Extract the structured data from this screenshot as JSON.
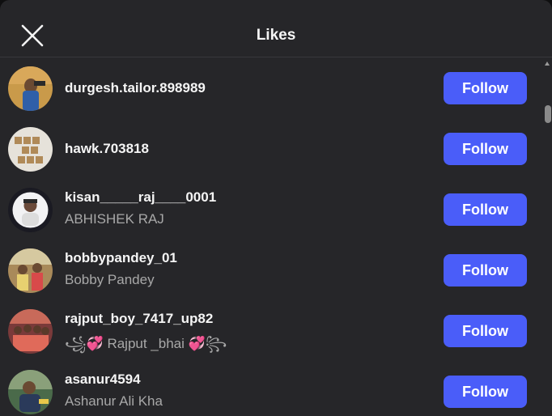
{
  "dialog": {
    "title": "Likes",
    "close_icon": "close-x-icon"
  },
  "users": [
    {
      "username": "durgesh.tailor.898989",
      "fullname": "",
      "button": "Follow",
      "avatar_color": "#3a6fb0"
    },
    {
      "username": "hawk.703818",
      "fullname": "",
      "button": "Follow",
      "avatar_color": "#c9b08a"
    },
    {
      "username": "kisan_____raj____0001",
      "fullname": "ABHISHEK RAJ",
      "button": "Follow",
      "avatar_color": "#e8e8ea"
    },
    {
      "username": "bobbypandey_01",
      "fullname": "Bobby Pandey",
      "button": "Follow",
      "avatar_color": "#b79a6a"
    },
    {
      "username": "rajput_boy_7417_up82",
      "fullname": "꧁💞 Rajput _bhai 💞꧂",
      "button": "Follow",
      "avatar_color": "#9a4a46"
    },
    {
      "username": "asanur4594",
      "fullname": "Ashanur Ali Kha",
      "button": "Follow",
      "avatar_color": "#5a7a5a"
    }
  ],
  "colors": {
    "background": "#262629",
    "follow_button": "#4a5df9",
    "primary_text": "#f5f5f5",
    "secondary_text": "#a8a8a8"
  }
}
